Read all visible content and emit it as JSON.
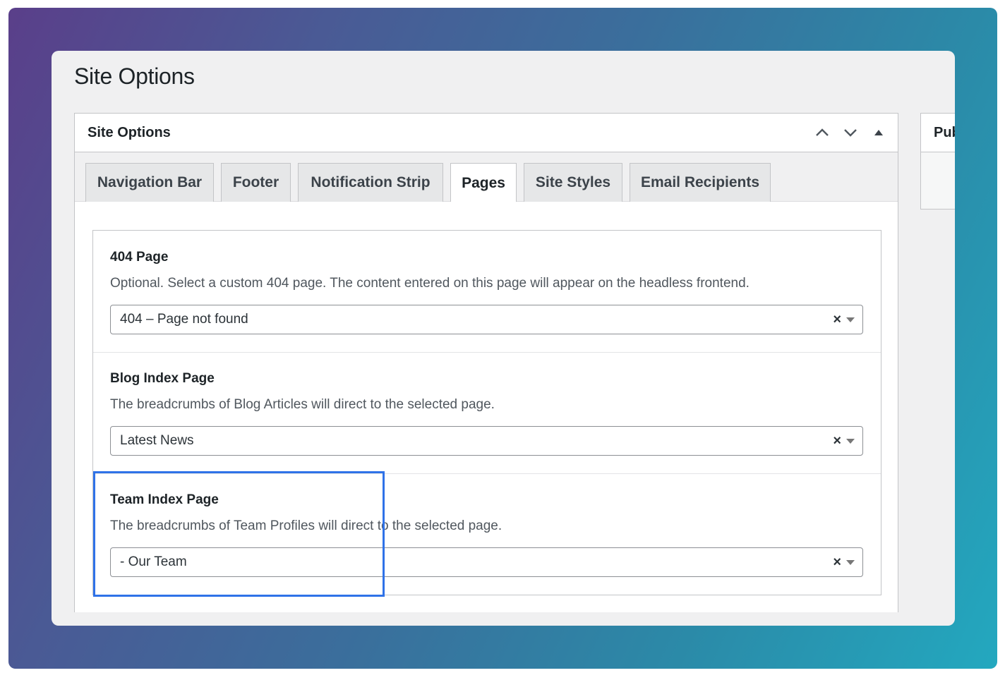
{
  "page": {
    "title": "Site Options"
  },
  "postbox": {
    "title": "Site Options",
    "icons": [
      "chevron-up-icon",
      "chevron-down-icon",
      "triangle-up-icon"
    ]
  },
  "tabs": [
    {
      "label": "Navigation Bar",
      "active": false
    },
    {
      "label": "Footer",
      "active": false
    },
    {
      "label": "Notification Strip",
      "active": false
    },
    {
      "label": "Pages",
      "active": true
    },
    {
      "label": "Site Styles",
      "active": false
    },
    {
      "label": "Email Recipients",
      "active": false
    }
  ],
  "fields": [
    {
      "label": "404 Page",
      "description": "Optional. Select a custom 404 page. The content entered on this page will appear on the headless frontend.",
      "value": "404 – Page not found"
    },
    {
      "label": "Blog Index Page",
      "description": "The breadcrumbs of Blog Articles will direct to the selected page.",
      "value": "Latest News"
    },
    {
      "label": "Team Index Page",
      "description": "The breadcrumbs of Team Profiles will direct to the selected page.",
      "value": "- Our Team"
    }
  ],
  "select_clear_glyph": "×",
  "side_box": {
    "title": "Publish"
  },
  "colors": {
    "highlight": "#2f72e8",
    "background_start": "#5a3f8a",
    "background_end": "#23a8bf"
  }
}
